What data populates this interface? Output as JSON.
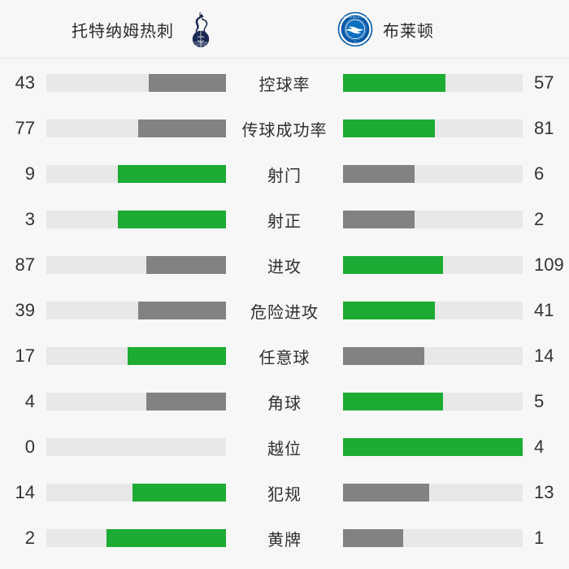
{
  "header": {
    "home_team": "托特纳姆热刺",
    "away_team": "布莱顿",
    "home_crest_icon": "tottenham-cockerel-crest-icon",
    "away_crest_icon": "brighton-seagull-crest-icon"
  },
  "colors": {
    "green": "#1dab34",
    "gray": "#828282",
    "track": "#e8e8e8",
    "background": "#f7f7f7",
    "text": "#333333",
    "home_crest": "#1b2a54",
    "away_crest": "#0057a8"
  },
  "chart_data": {
    "type": "bar",
    "title": "托特纳姆热刺 vs 布莱顿",
    "xlabel": "",
    "ylabel": "",
    "legend_position": "top",
    "series": [
      {
        "name": "托特纳姆热刺",
        "values": [
          43,
          77,
          9,
          3,
          87,
          39,
          17,
          4,
          0,
          14,
          2
        ]
      },
      {
        "name": "布莱顿",
        "values": [
          57,
          81,
          6,
          2,
          109,
          41,
          14,
          5,
          4,
          13,
          1
        ]
      }
    ],
    "categories": [
      "控球率",
      "传球成功率",
      "射门",
      "射正",
      "进攻",
      "危险进攻",
      "任意球",
      "角球",
      "越位",
      "犯规",
      "黄牌"
    ],
    "rows": [
      {
        "label": "控球率",
        "home_value": "43",
        "away_value": "57",
        "home_pct": 43,
        "away_pct": 57,
        "home_color": "gray",
        "away_color": "green"
      },
      {
        "label": "传球成功率",
        "home_value": "77",
        "away_value": "81",
        "home_pct": 48.7,
        "away_pct": 51.3,
        "home_color": "gray",
        "away_color": "green"
      },
      {
        "label": "射门",
        "home_value": "9",
        "away_value": "6",
        "home_pct": 60,
        "away_pct": 40,
        "home_color": "green",
        "away_color": "gray"
      },
      {
        "label": "射正",
        "home_value": "3",
        "away_value": "2",
        "home_pct": 60,
        "away_pct": 40,
        "home_color": "green",
        "away_color": "gray"
      },
      {
        "label": "进攻",
        "home_value": "87",
        "away_value": "109",
        "home_pct": 44.4,
        "away_pct": 55.6,
        "home_color": "gray",
        "away_color": "green"
      },
      {
        "label": "危险进攻",
        "home_value": "39",
        "away_value": "41",
        "home_pct": 48.8,
        "away_pct": 51.2,
        "home_color": "gray",
        "away_color": "green"
      },
      {
        "label": "任意球",
        "home_value": "17",
        "away_value": "14",
        "home_pct": 54.8,
        "away_pct": 45.2,
        "home_color": "green",
        "away_color": "gray"
      },
      {
        "label": "角球",
        "home_value": "4",
        "away_value": "5",
        "home_pct": 44.4,
        "away_pct": 55.6,
        "home_color": "gray",
        "away_color": "green"
      },
      {
        "label": "越位",
        "home_value": "0",
        "away_value": "4",
        "home_pct": 0,
        "away_pct": 100,
        "home_color": "gray",
        "away_color": "green"
      },
      {
        "label": "犯规",
        "home_value": "14",
        "away_value": "13",
        "home_pct": 51.9,
        "away_pct": 48.1,
        "home_color": "green",
        "away_color": "gray"
      },
      {
        "label": "黄牌",
        "home_value": "2",
        "away_value": "1",
        "home_pct": 66.7,
        "away_pct": 33.3,
        "home_color": "green",
        "away_color": "gray"
      }
    ]
  }
}
